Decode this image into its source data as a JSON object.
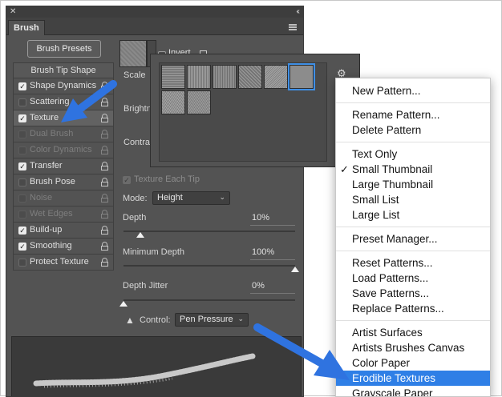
{
  "window": {
    "title_close": "✕",
    "title_collapse": "‹‹"
  },
  "panel": {
    "tab_label": "Brush",
    "presets_button": "Brush Presets"
  },
  "left_list": [
    {
      "label": "Brush Tip Shape",
      "state": "header",
      "lock": false
    },
    {
      "label": "Shape Dynamics",
      "state": "checked",
      "lock": true
    },
    {
      "label": "Scattering",
      "state": "unchecked",
      "lock": true
    },
    {
      "label": "Texture",
      "state": "checked-selected",
      "lock": true
    },
    {
      "label": "Dual Brush",
      "state": "disabled",
      "lock": true
    },
    {
      "label": "Color Dynamics",
      "state": "disabled",
      "lock": true
    },
    {
      "label": "Transfer",
      "state": "checked",
      "lock": true
    },
    {
      "label": "Brush Pose",
      "state": "unchecked",
      "lock": true
    },
    {
      "label": "Noise",
      "state": "disabled",
      "lock": true
    },
    {
      "label": "Wet Edges",
      "state": "disabled",
      "lock": true
    },
    {
      "label": "Build-up",
      "state": "checked",
      "lock": true
    },
    {
      "label": "Smoothing",
      "state": "checked",
      "lock": true
    },
    {
      "label": "Protect Texture",
      "state": "unchecked",
      "lock": true
    }
  ],
  "texture": {
    "invert_label": "Invert",
    "scale_label": "Scale",
    "brightness_label": "Brightn",
    "contrast_label": "Contras",
    "texture_each_tip_label": "Texture Each Tip",
    "mode_label": "Mode:",
    "mode_value": "Height",
    "depth_label": "Depth",
    "depth_value": "10%",
    "depth_fraction": 0.1,
    "min_depth_label": "Minimum Depth",
    "min_depth_value": "100%",
    "min_depth_fraction": 1.0,
    "depth_jitter_label": "Depth Jitter",
    "depth_jitter_value": "0%",
    "depth_jitter_fraction": 0.0,
    "control_label": "Control:",
    "control_value": "Pen Pressure"
  },
  "picker": {
    "thumbnail_count": 8,
    "selected_index": 5
  },
  "context_menu": {
    "groups": [
      [
        "New Pattern..."
      ],
      [
        "Rename Pattern...",
        "Delete Pattern"
      ],
      [
        "Text Only",
        "Small Thumbnail",
        "Large Thumbnail",
        "Small List",
        "Large List"
      ],
      [
        "Preset Manager..."
      ],
      [
        "Reset Patterns...",
        "Load Patterns...",
        "Save Patterns...",
        "Replace Patterns..."
      ],
      [
        "Artist Surfaces",
        "Artists Brushes Canvas",
        "Color Paper",
        "Erodible Textures",
        "Grayscale Paper"
      ]
    ],
    "checked_item": "Small Thumbnail",
    "highlighted_item": "Erodible Textures"
  },
  "colors": {
    "panel_bg": "#535353",
    "highlight": "#2f7fe6",
    "annotation_arrow": "#3c7fe6"
  }
}
